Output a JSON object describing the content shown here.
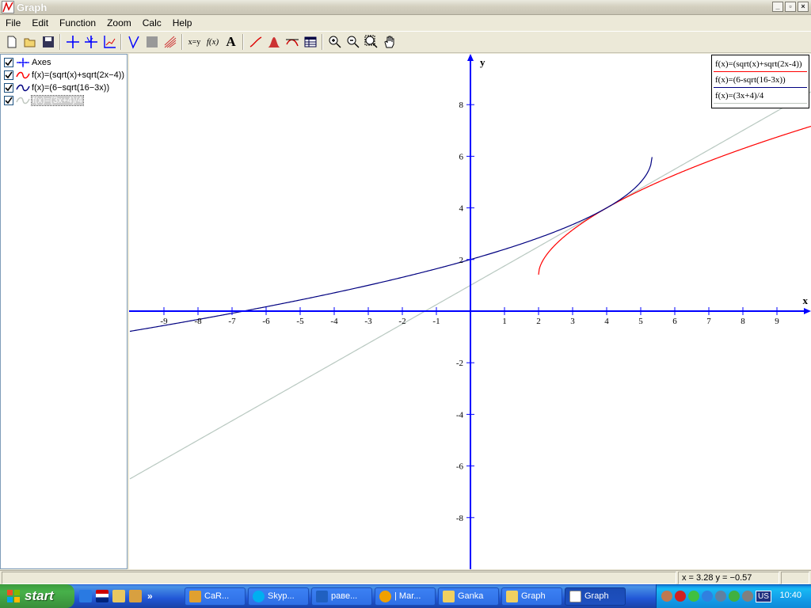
{
  "window": {
    "title": "Graph"
  },
  "menu": {
    "items": [
      "File",
      "Edit",
      "Function",
      "Zoom",
      "Calc",
      "Help"
    ]
  },
  "toolbar": {
    "xy_label": "x=y",
    "fx_label": "f(x)",
    "text_label": "A"
  },
  "sidebar": {
    "items": [
      {
        "label": "Axes",
        "color": "#0000ff",
        "checked": true
      },
      {
        "label": "f(x)=(sqrt(x)+sqrt(2x−4))",
        "color": "#ff0000",
        "checked": true
      },
      {
        "label": "f(x)=(6−sqrt(16−3x))",
        "color": "#000080",
        "checked": true
      },
      {
        "label": "f(x)=(3x+4)/4",
        "color": "#c0c0c0",
        "checked": true,
        "selected": true
      }
    ]
  },
  "chart_data": {
    "type": "line",
    "xlabel": "x",
    "ylabel": "y",
    "xlim": [
      -10,
      10
    ],
    "ylim": [
      -10,
      10
    ],
    "x_ticks": [
      -9,
      -8,
      -7,
      -6,
      -5,
      -4,
      -3,
      -2,
      -1,
      1,
      2,
      3,
      4,
      5,
      6,
      7,
      8,
      9
    ],
    "y_ticks": [
      8,
      6,
      4,
      2,
      -2,
      -4,
      -6,
      -8
    ],
    "grid": false,
    "legend_position": "top-right",
    "axes_color": "#0000ff",
    "series": [
      {
        "name": "f(x)=(sqrt(x)+sqrt(2x-4))",
        "expr": "sqrt(x)+sqrt(2x-4)",
        "color": "#ff0000",
        "domain": [
          2,
          10
        ]
      },
      {
        "name": "f(x)=(6-sqrt(16-3x))",
        "expr": "6-sqrt(16-3x)",
        "color": "#000080",
        "domain": [
          -10,
          5.333
        ]
      },
      {
        "name": "f(x)=(3x+4)/4",
        "expr": "(3x+4)/4",
        "color": "#b8c8c0",
        "domain": [
          -10,
          10
        ]
      }
    ]
  },
  "statusbar": {
    "coords": "x = 3.28    y = −0.57"
  },
  "taskbar": {
    "start_label": "start",
    "more": "»",
    "tasks": [
      {
        "label": "CaR...",
        "icon_color": "#e0a030"
      },
      {
        "label": "Skyp...",
        "icon_color": "#00aff0"
      },
      {
        "label": "раве...",
        "icon_color": "#2060c0"
      },
      {
        "label": "| Mar...",
        "icon_color": "#f0a000"
      },
      {
        "label": "Ganka",
        "icon_color": "#f0d060"
      },
      {
        "label": "Graph",
        "icon_color": "#f0d060"
      },
      {
        "label": "Graph",
        "icon_color": "#ffffff",
        "active": true
      }
    ],
    "lang": "US",
    "clock": "10:40"
  }
}
